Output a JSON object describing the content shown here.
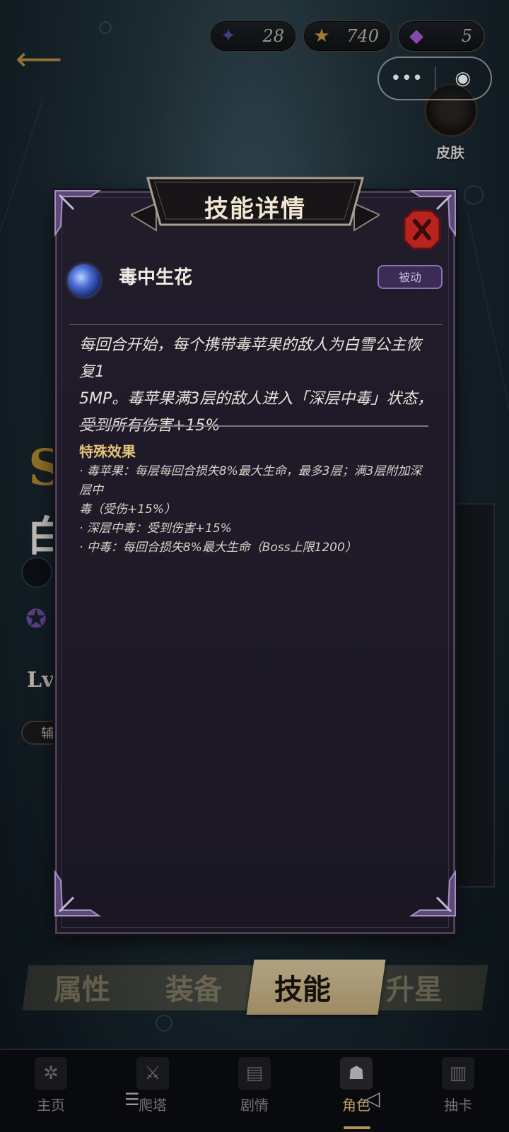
{
  "resources": [
    {
      "icon": "scorpion-icon",
      "value": "28"
    },
    {
      "icon": "star-icon",
      "value": "740"
    },
    {
      "icon": "crystal-card-icon",
      "value": "5"
    }
  ],
  "capsule": {
    "more": "•••",
    "target": "◉"
  },
  "skin": {
    "label": "皮肤"
  },
  "background": {
    "partial_letter": "S",
    "partial_char": "白",
    "partial_level": "Lv.",
    "partial_tag": "辅"
  },
  "modal": {
    "title": "技能详情",
    "skill_name": "毒中生花",
    "skill_type": "被动",
    "description_lines": [
      "每回合开始，每个携带毒苹果的敌人为白雪公主恢复1",
      "5MP。毒苹果满3层的敌人进入「深层中毒」状态，",
      "受到所有伤害+15%"
    ],
    "special_title": "特殊效果",
    "effects": [
      "· 毒苹果：每层每回合损失8%最大生命，最多3层；满3层附加深层中",
      "毒（受伤+15%）",
      "· 深层中毒：受到伤害+15%",
      "· 中毒：每回合损失8%最大生命（Boss上限1200）"
    ]
  },
  "tabs": [
    {
      "label": "属性",
      "active": false
    },
    {
      "label": "装备",
      "active": false
    },
    {
      "label": "技能",
      "active": true
    },
    {
      "label": "升星",
      "active": false
    }
  ],
  "nav": [
    {
      "label": "主页",
      "icon": "compass-icon",
      "active": false
    },
    {
      "label": "爬塔",
      "icon": "crossed-swords-icon",
      "active": false
    },
    {
      "label": "剧情",
      "icon": "book-icon",
      "active": false
    },
    {
      "label": "角色",
      "icon": "hooded-figure-icon",
      "active": true
    },
    {
      "label": "抽卡",
      "icon": "card-stack-icon",
      "active": false
    }
  ],
  "colors": {
    "accent_gold": "#e2c17a",
    "passive_purple": "#8d6fc2",
    "close_red": "#b8231f"
  }
}
